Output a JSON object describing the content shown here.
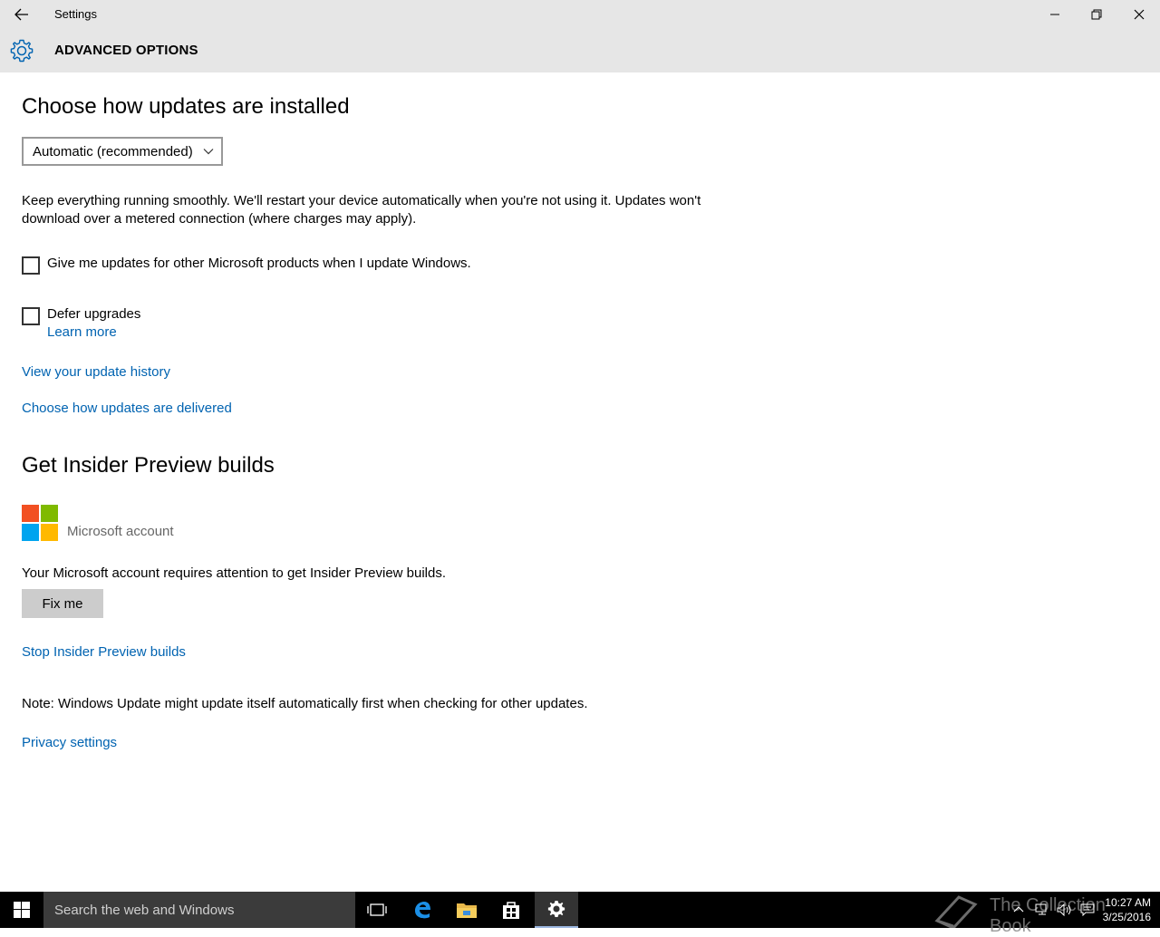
{
  "window": {
    "title": "Settings",
    "page_title": "ADVANCED OPTIONS"
  },
  "updates": {
    "heading": "Choose how updates are installed",
    "dropdown_value": "Automatic (recommended)",
    "description": "Keep everything running smoothly. We'll restart your device automatically when you're not using it. Updates won't download over a metered connection (where charges may apply).",
    "checkbox_other_products": "Give me updates for other Microsoft products when I update Windows.",
    "checkbox_defer": "Defer upgrades",
    "learn_more": "Learn more",
    "update_history_link": "View your update history",
    "delivery_link": "Choose how updates are delivered"
  },
  "insider": {
    "heading": "Get Insider Preview builds",
    "account_label": "Microsoft account",
    "attention_text": "Your Microsoft account requires attention to get Insider Preview builds.",
    "fix_button": "Fix me",
    "stop_link": "Stop Insider Preview builds",
    "note": "Note: Windows Update might update itself automatically first when checking for other updates.",
    "privacy_link": "Privacy settings"
  },
  "taskbar": {
    "search_placeholder": "Search the web and Windows",
    "time": "10:27 AM",
    "date": "3/25/2016",
    "watermark": "The Collection Book"
  },
  "colors": {
    "accent": "#0063b1",
    "titlebar": "#e6e6e6",
    "ms_logo": [
      "#f25022",
      "#7fba00",
      "#00a4ef",
      "#ffb900"
    ]
  },
  "icons": [
    "back-arrow-icon",
    "minimize-icon",
    "restore-icon",
    "close-icon",
    "gear-icon",
    "chevron-down-icon",
    "windows-logo-icon",
    "task-view-icon",
    "edge-icon",
    "file-explorer-icon",
    "store-icon",
    "settings-icon",
    "chevron-up-icon",
    "network-icon",
    "volume-icon",
    "action-center-icon"
  ]
}
